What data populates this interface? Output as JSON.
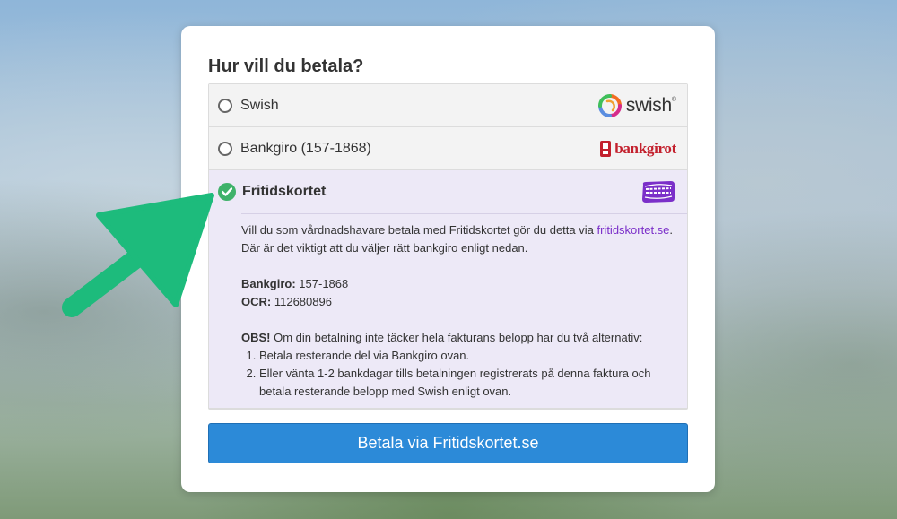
{
  "form": {
    "title": "Hur vill du betala?",
    "options": [
      {
        "label": "Swish",
        "logo_icon": "swish-logo-icon",
        "logo_text": "swish",
        "logo_mark": "®",
        "selected": false
      },
      {
        "label": "Bankgiro (157-1868)",
        "logo_icon": "bankgirot-logo-icon",
        "logo_text": "bankgirot",
        "selected": false
      },
      {
        "label": "Fritidskortet",
        "logo_icon": "fritidskortet-logo-icon",
        "logo_text": "FRITIDS KORTET",
        "selected": true
      }
    ],
    "details": {
      "intro_text": "Vill du som vårdnadshavare betala med Fritidskortet gör du detta via",
      "link_text": "fritidskortet.se",
      "intro_rest": ". Där är det viktigt att du väljer rätt bankgiro enligt nedan.",
      "bankgiro_label": "Bankgiro:",
      "bankgiro_value": "157-1868",
      "ocr_label": "OCR:",
      "ocr_value": "112680896",
      "obs_label": "OBS!",
      "obs_text": "Om din betalning inte täcker hela fakturans belopp har du två alternativ:",
      "alternatives": [
        "Betala resterande del via Bankgiro ovan.",
        "Eller vänta 1-2 bankdagar tills betalningen registrerats på denna faktura och betala resterande belopp med Swish enligt ovan."
      ]
    },
    "button_label": "Betala via Fritidskortet.se"
  },
  "colors": {
    "accent_button": "#2c8ad8",
    "selected_bg": "#ede9f7",
    "check_green": "#3fb26a",
    "link_purple": "#7b2fc9",
    "arrow_green": "#1dbb7c",
    "bankgirot_red": "#c3202d"
  }
}
